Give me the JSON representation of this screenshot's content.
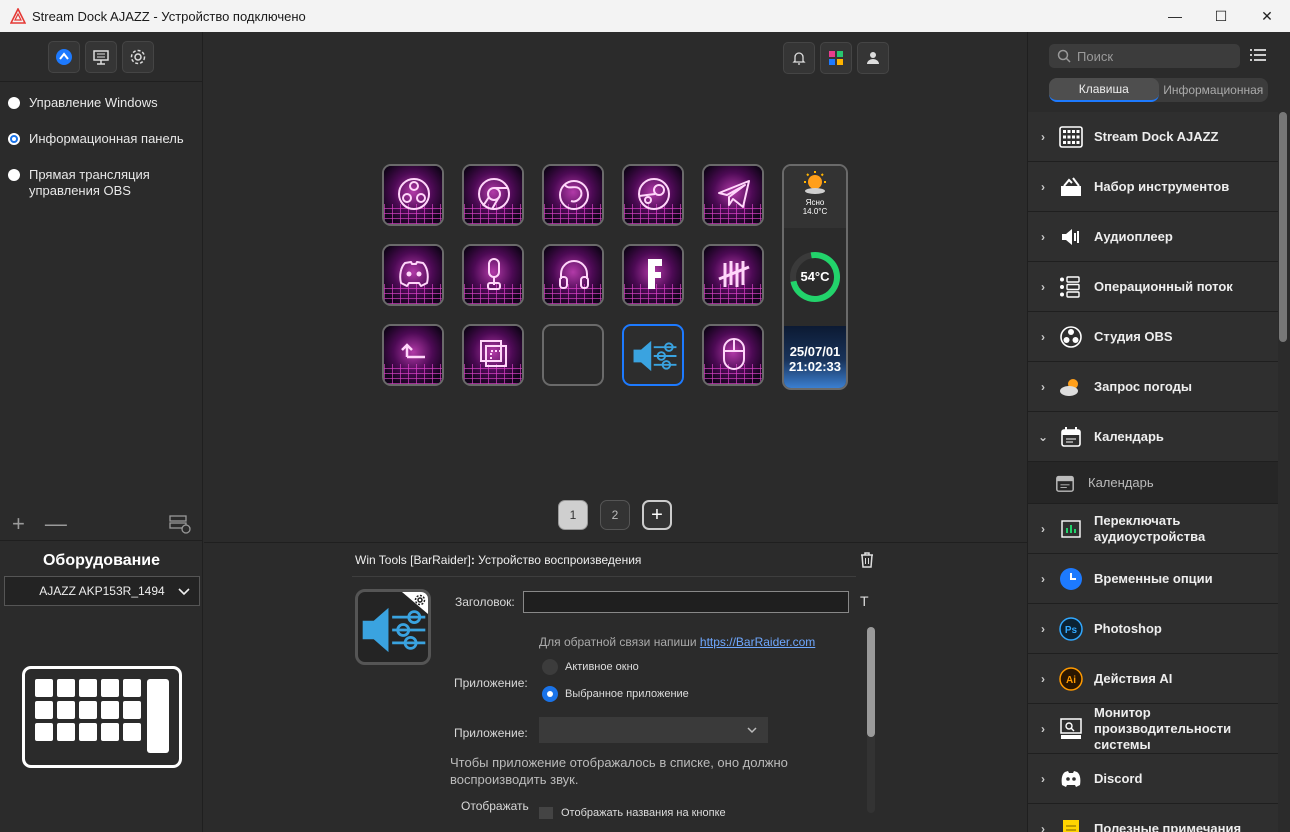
{
  "window": {
    "title": "Stream Dock AJAZZ - Устройство подключено",
    "minimize": "—",
    "maximize": "☐",
    "close": "✕"
  },
  "profiles": [
    {
      "label": "Управление Windows",
      "selected": false
    },
    {
      "label": "Информационная панель",
      "selected": true
    },
    {
      "label": "Прямая трансляция управления OBS",
      "selected": false
    }
  ],
  "left_actions": {
    "add": "+",
    "remove": "—"
  },
  "hardware": {
    "title": "Оборудование",
    "device": "AJAZZ AKP153R_1494"
  },
  "tall_widget": {
    "weather_text": "Ясно",
    "weather_temp": "14.0°C",
    "cpu_temp": "54°C",
    "date": "25/07/01",
    "time": "21:02:33"
  },
  "pages": {
    "p1": "1",
    "p2": "2",
    "add": "+"
  },
  "props": {
    "plugin": "Win Tools [BarRaider]",
    "separator": ": ",
    "action": "Устройство воспроизведения",
    "title_label": "Заголовок:",
    "t_icon": "T",
    "feedback": "Для обратной связи напиши",
    "feedback_link": "https://BarRaider.com",
    "app_label": "Приложение:",
    "app_label2": "Приложение:",
    "opt_active": "Активное окно",
    "opt_selected": "Выбранное приложение",
    "hint": "Чтобы приложение отображалось в списке, оно должно воспроизводить звук.",
    "show_label": "Отображать",
    "show_checkbox": "Отображать названия на кнопке"
  },
  "right": {
    "search_placeholder": "Поиск",
    "tab_key": "Клавиша",
    "tab_info": "Информационная",
    "plugins": [
      {
        "label": "Stream Dock AJAZZ",
        "icon": "keypad-icon"
      },
      {
        "label": "Набор инструментов",
        "icon": "toolbox-icon"
      },
      {
        "label": "Аудиоплеер",
        "icon": "speaker-icon"
      },
      {
        "label": "Операционный поток",
        "icon": "flow-icon"
      },
      {
        "label": "Студия OBS",
        "icon": "obs-icon"
      },
      {
        "label": "Запрос погоды",
        "icon": "weather-icon"
      },
      {
        "label": "Календарь",
        "icon": "calendar-icon",
        "expanded": true
      },
      {
        "label": "Календарь",
        "icon": "calendar-icon",
        "sub": true
      },
      {
        "label": "Переключать аудиоустройства",
        "icon": "audio-switch-icon"
      },
      {
        "label": "Временные опции",
        "icon": "clock-icon"
      },
      {
        "label": "Photoshop",
        "icon": "photoshop-icon"
      },
      {
        "label": "Действия AI",
        "icon": "illustrator-icon"
      },
      {
        "label": "Монитор производительности системы",
        "icon": "monitor-icon"
      },
      {
        "label": "Discord",
        "icon": "discord-icon"
      },
      {
        "label": "Полезные примечания",
        "icon": "notes-icon"
      }
    ]
  },
  "colors": {
    "accent": "#1d7aff",
    "neon": "#ff4fe6",
    "bg": "#2b2b2b"
  }
}
